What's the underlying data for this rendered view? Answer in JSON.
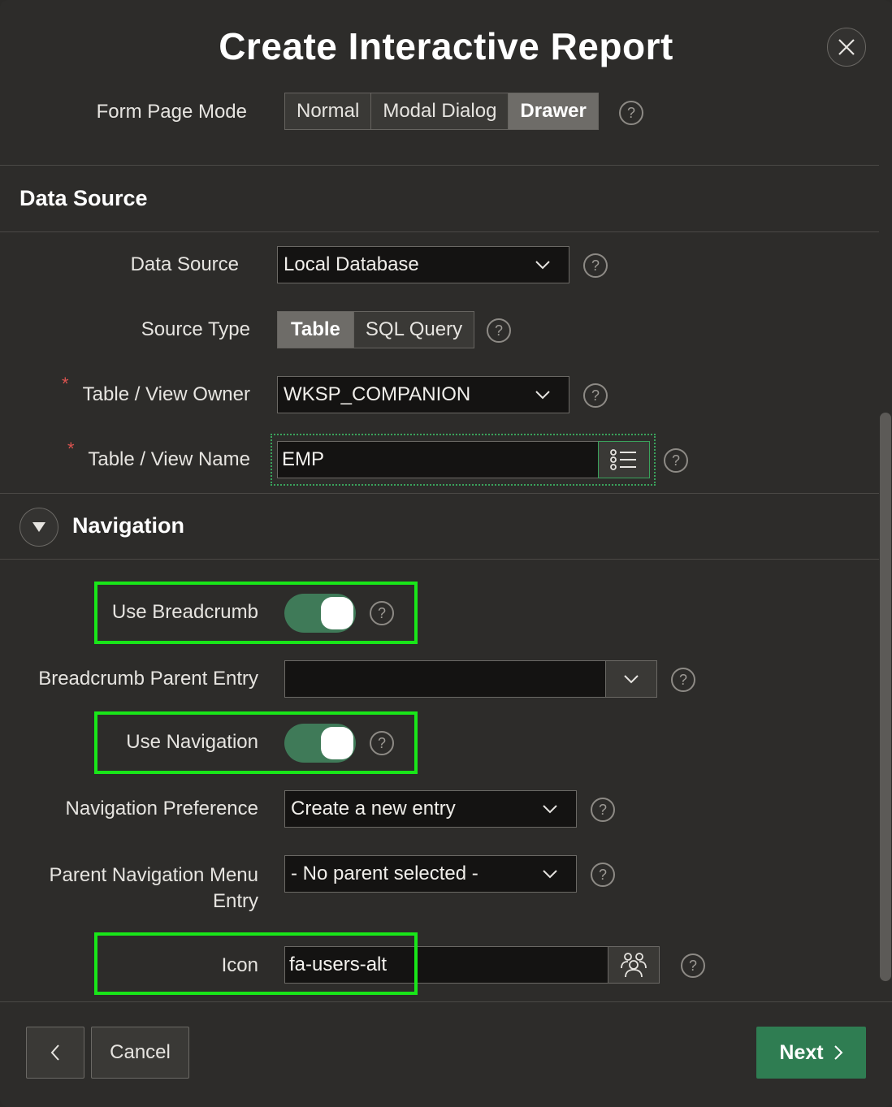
{
  "dialog": {
    "title": "Create Interactive Report",
    "close_icon": "close-icon"
  },
  "form_page_mode": {
    "label": "Form Page Mode",
    "options": [
      "Normal",
      "Modal Dialog",
      "Drawer"
    ],
    "selected": "Drawer"
  },
  "data_source_section": {
    "title": "Data Source",
    "data_source": {
      "label": "Data Source",
      "value": "Local Database"
    },
    "source_type": {
      "label": "Source Type",
      "options": [
        "Table",
        "SQL Query"
      ],
      "selected": "Table"
    },
    "table_owner": {
      "label": "Table / View Owner",
      "value": "WKSP_COMPANION",
      "required": "*"
    },
    "table_name": {
      "label": "Table / View Name",
      "value": "EMP",
      "required": "*",
      "lov_icon": "list-icon"
    }
  },
  "navigation_section": {
    "title": "Navigation",
    "use_breadcrumb": {
      "label": "Use Breadcrumb",
      "on": true
    },
    "breadcrumb_parent": {
      "label": "Breadcrumb Parent Entry",
      "value": ""
    },
    "use_navigation": {
      "label": "Use Navigation",
      "on": true
    },
    "navigation_preference": {
      "label": "Navigation Preference",
      "value": "Create a new entry"
    },
    "parent_nav_menu": {
      "label_line1": "Parent Navigation Menu",
      "label_line2": "Entry",
      "value": "- No parent selected -"
    },
    "icon": {
      "label": "Icon",
      "value": "fa-users-alt",
      "picker_icon": "users-icon"
    }
  },
  "help_glyph": "?",
  "footer": {
    "back_icon": "chevron-left-icon",
    "cancel_label": "Cancel",
    "next_label": "Next",
    "next_icon": "chevron-right-icon"
  },
  "colors": {
    "highlight": "#19e619",
    "primary_button": "#2f7d52",
    "toggle_on": "#3f7a58",
    "required": "#d9534f"
  }
}
